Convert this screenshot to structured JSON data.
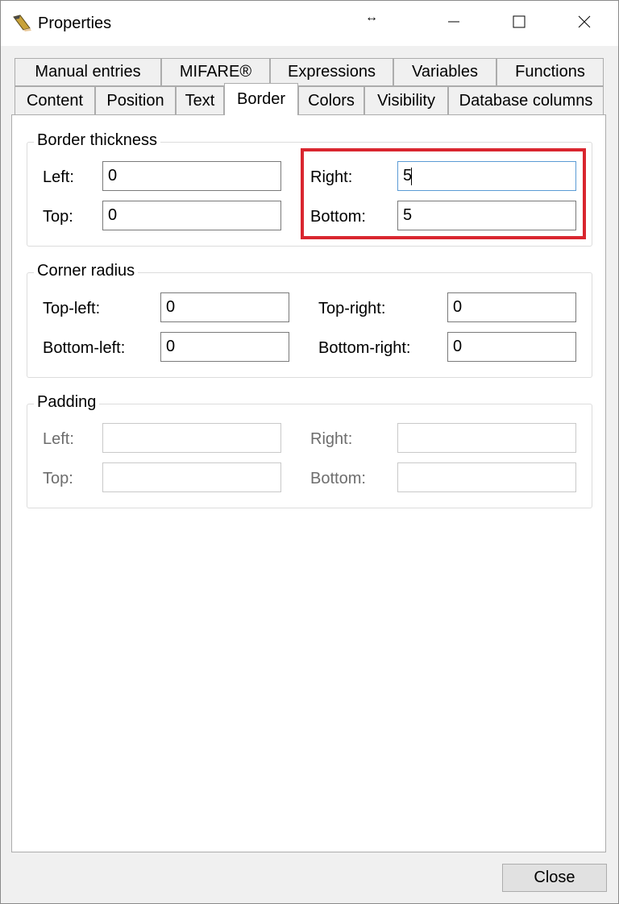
{
  "window": {
    "title": "Properties",
    "resize_glyph": "↔",
    "colors": {
      "highlight": "#d9262f",
      "focus": "#5b9bd5"
    }
  },
  "tabs": {
    "row1": [
      "Manual entries",
      "MIFARE®",
      "Expressions",
      "Variables",
      "Functions"
    ],
    "row2": [
      "Content",
      "Position",
      "Text",
      "Border",
      "Colors",
      "Visibility",
      "Database columns"
    ],
    "active": "Border"
  },
  "border_thickness": {
    "legend": "Border thickness",
    "left_label": "Left:",
    "left_value": "0",
    "top_label": "Top:",
    "top_value": "0",
    "right_label": "Right:",
    "right_value": "5",
    "bottom_label": "Bottom:",
    "bottom_value": "5"
  },
  "corner_radius": {
    "legend": "Corner radius",
    "top_left_label": "Top-left:",
    "top_left_value": "0",
    "bottom_left_label": "Bottom-left:",
    "bottom_left_value": "0",
    "top_right_label": "Top-right:",
    "top_right_value": "0",
    "bottom_right_label": "Bottom-right:",
    "bottom_right_value": "0"
  },
  "padding": {
    "legend": "Padding",
    "left_label": "Left:",
    "left_value": "",
    "top_label": "Top:",
    "top_value": "",
    "right_label": "Right:",
    "right_value": "",
    "bottom_label": "Bottom:",
    "bottom_value": ""
  },
  "footer": {
    "close_label": "Close"
  },
  "icons": {
    "app": "pencil-icon",
    "resize": "resize-horizontal-icon",
    "minimize": "minimize-icon",
    "maximize": "maximize-icon",
    "close": "close-icon"
  }
}
